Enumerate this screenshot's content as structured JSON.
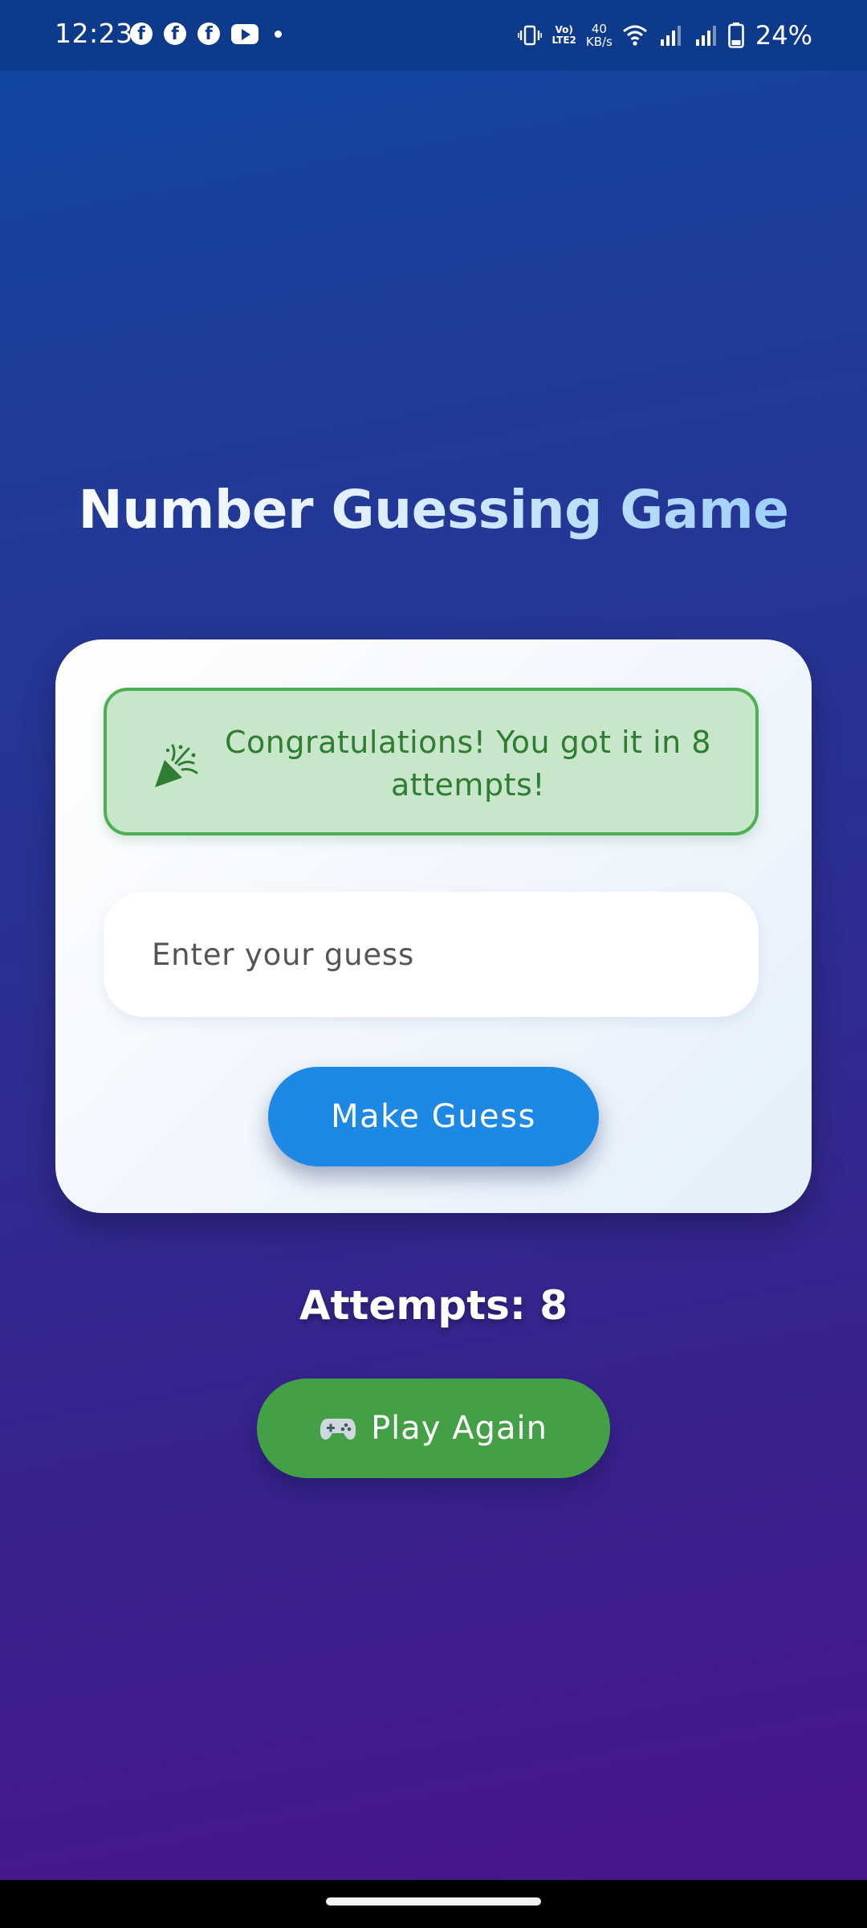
{
  "status_bar": {
    "time": "12:23",
    "notification_icons": [
      "facebook-icon",
      "facebook-icon",
      "facebook-icon",
      "youtube-icon",
      "more-dot-icon"
    ],
    "volte_line1": "Vo)",
    "volte_line2": "LTE2",
    "net_speed_value": "40",
    "net_speed_unit": "KB/s",
    "battery_percent": "24%"
  },
  "app": {
    "title": "Number Guessing Game"
  },
  "card": {
    "message": "Congratulations! You got it in 8 attempts!",
    "message_icon": "party-popper-icon",
    "guess_input": {
      "placeholder": "Enter your guess",
      "value": ""
    },
    "make_guess_label": "Make Guess"
  },
  "attempts_label": "Attempts: 8",
  "play_again": {
    "icon": "gamepad-icon",
    "label": "Play Again"
  },
  "colors": {
    "status_bar": "#0e3a8c",
    "success_bg": "#c8e6c9",
    "success_border": "#4caf50",
    "success_text": "#2e7d32",
    "primary_button": "#1e88e5",
    "play_again_button": "#43a047"
  }
}
